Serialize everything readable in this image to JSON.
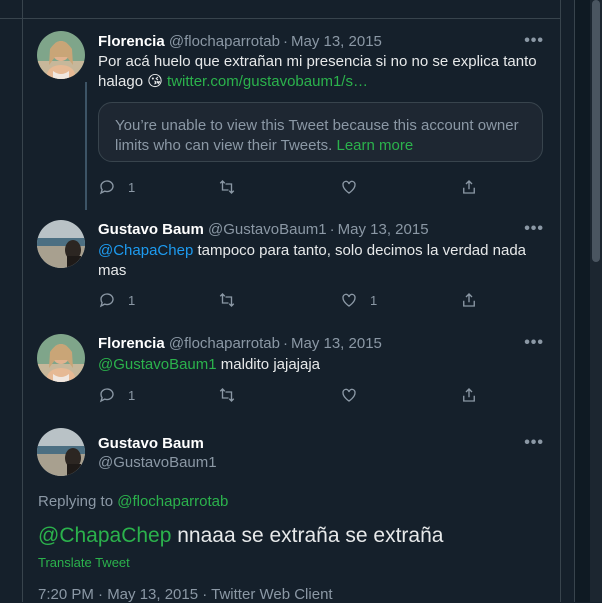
{
  "tweets": [
    {
      "name": "Florencia",
      "handle": "@flochaparrotab",
      "date": "May 13, 2015",
      "text_plain": "Por acá huelo que extrañan mi presencia si no no se explica tanto halago",
      "emoji": "😘",
      "link": "twitter.com/gustavobaum1/s…",
      "quoted_notice": "You’re unable to view this Tweet because this account owner limits who can view their Tweets.",
      "learn_more": "Learn more",
      "replies": "1",
      "likes": ""
    },
    {
      "name": "Gustavo Baum",
      "handle": "@GustavoBaum1",
      "date": "May 13, 2015",
      "mention": "@ChapaChep",
      "text_plain": "tampoco para tanto, solo decimos la verdad nada mas",
      "replies": "1",
      "likes": "1"
    },
    {
      "name": "Florencia",
      "handle": "@flochaparrotab",
      "date": "May 13, 2015",
      "mention": "@GustavoBaum1",
      "text_plain": "maldito jajajaja",
      "replies": "1",
      "likes": ""
    }
  ],
  "main_tweet": {
    "name": "Gustavo Baum",
    "handle": "@GustavoBaum1",
    "replying_prefix": "Replying to",
    "replying_to": "@flochaparrotab",
    "mention": "@ChapaChep",
    "text_plain": "nnaaa se extraña se extraña",
    "translate": "Translate Tweet",
    "meta": "7:20 PM · May 13, 2015 · Twitter Web Client"
  },
  "more_label": "•••",
  "dot": "·",
  "colors": {
    "background": "#15202b",
    "link": "#1d9bf0",
    "green_link": "#2bb24c",
    "muted": "#8b98a5",
    "border": "#38444d"
  },
  "icons": [
    "reply-icon",
    "retweet-icon",
    "like-icon",
    "share-icon",
    "more-icon"
  ]
}
